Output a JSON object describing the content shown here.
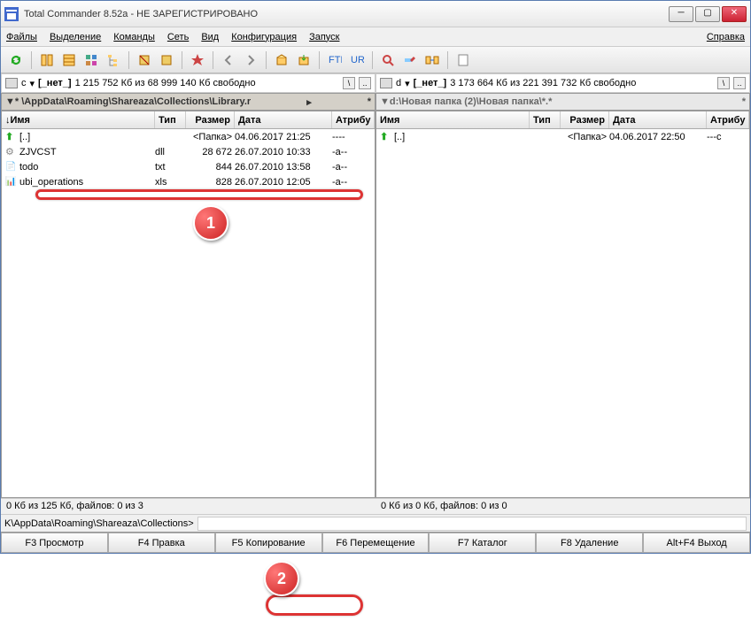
{
  "title": "Total Commander 8.52a - НЕ ЗАРЕГИСТРИРОВАНО",
  "menu": {
    "files": "Файлы",
    "selection": "Выделение",
    "commands": "Команды",
    "net": "Сеть",
    "view": "Вид",
    "config": "Конфигурация",
    "run": "Запуск",
    "help": "Справка"
  },
  "drives": {
    "left": {
      "letter": "c",
      "label": "[_нет_]",
      "free": "1 215 752 Кб из 68 999 140 Кб свободно"
    },
    "right": {
      "letter": "d",
      "label": "[_нет_]",
      "free": "3 173 664 Кб из 221 391 732 Кб свободно"
    }
  },
  "paths": {
    "left": "* \\AppData\\Roaming\\Shareaza\\Collections\\Library.r",
    "right": "d:\\Новая папка (2)\\Новая папка\\*.*"
  },
  "columns": {
    "name": "Имя",
    "ext": "Тип",
    "size": "Размер",
    "date": "Дата",
    "attr": "Атрибу"
  },
  "left_files": [
    {
      "icon": "up",
      "name": "[..]",
      "ext": "",
      "size": "<Папка>",
      "date": "04.06.2017 21:25",
      "attr": "----"
    },
    {
      "icon": "dll",
      "name": "ZJVCST",
      "ext": "dll",
      "size": "28 672",
      "date": "26.07.2010 10:33",
      "attr": "-a--"
    },
    {
      "icon": "txt",
      "name": "todo",
      "ext": "txt",
      "size": "844",
      "date": "26.07.2010 13:58",
      "attr": "-a--",
      "selected": true
    },
    {
      "icon": "xls",
      "name": "ubi_operations",
      "ext": "xls",
      "size": "828",
      "date": "26.07.2010 12:05",
      "attr": "-a--"
    }
  ],
  "right_files": [
    {
      "icon": "up",
      "name": "[..]",
      "ext": "",
      "size": "<Папка>",
      "date": "04.06.2017 22:50",
      "attr": "---c"
    }
  ],
  "status": {
    "left": "0 Кб из 125 Кб, файлов: 0 из 3",
    "right": "0 Кб из 0 Кб, файлов: 0 из 0"
  },
  "cmdprompt": "K\\AppData\\Roaming\\Shareaza\\Collections>",
  "fnkeys": {
    "f3": "F3 Просмотр",
    "f4": "F4 Правка",
    "f5": "F5 Копирование",
    "f6": "F6 Перемещение",
    "f7": "F7 Каталог",
    "f8": "F8 Удаление",
    "altf4": "Alt+F4 Выход"
  },
  "callouts": {
    "c1": "1",
    "c2": "2"
  }
}
